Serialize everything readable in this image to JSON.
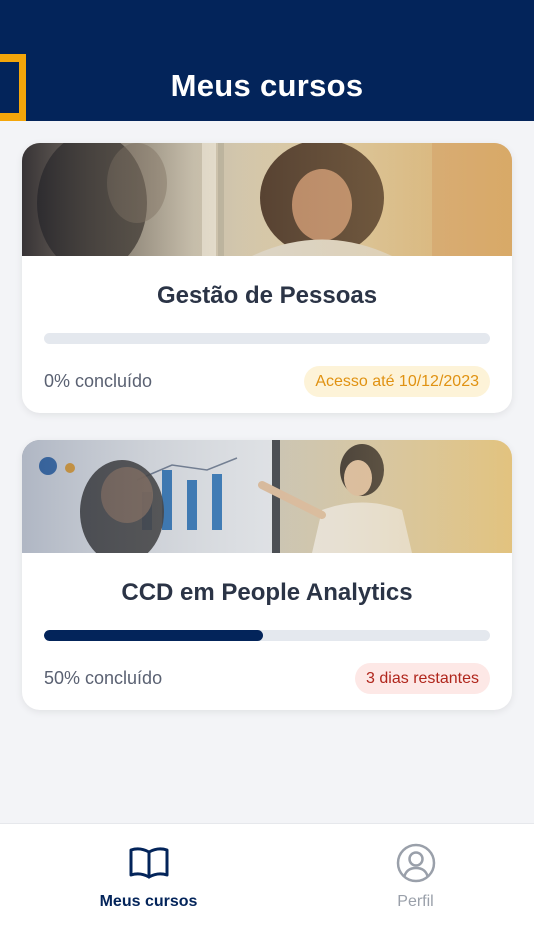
{
  "header": {
    "title": "Meus cursos"
  },
  "colors": {
    "primary": "#03245a",
    "accent": "#f4a60a",
    "warn_text": "#e09212",
    "warn_bg": "#fdf3d8",
    "danger_text": "#b0261c",
    "danger_bg": "#fde8e6"
  },
  "courses": [
    {
      "title": "Gestão de Pessoas",
      "progress_label": "0% concluído",
      "progress": 0,
      "badge": "Acesso até 10/12/2023",
      "badge_type": "warn",
      "image": "woman-smiling-office-photo"
    },
    {
      "title": "CCD em People Analytics",
      "progress_label": "50% concluído",
      "progress": 0.5,
      "badge": "3 dias restantes",
      "badge_type": "danger",
      "image": "presentation-chart-meeting-photo"
    }
  ],
  "bottom_nav": {
    "items": [
      {
        "label": "Meus cursos",
        "icon": "book-open-icon",
        "active": true
      },
      {
        "label": "Perfil",
        "icon": "user-circle-icon",
        "active": false
      }
    ]
  }
}
